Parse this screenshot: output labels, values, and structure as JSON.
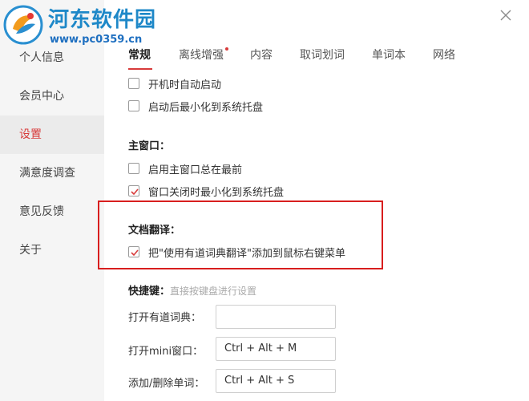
{
  "logo": {
    "title": "河东软件园",
    "url": "www.pc0359.cn"
  },
  "sidebar": {
    "items": [
      {
        "label": "个人信息"
      },
      {
        "label": "会员中心"
      },
      {
        "label": "设置"
      },
      {
        "label": "满意度调查"
      },
      {
        "label": "意见反馈"
      },
      {
        "label": "关于"
      }
    ],
    "active": "设置"
  },
  "tabs": [
    {
      "label": "常规",
      "active": true
    },
    {
      "label": "离线增强",
      "has_dot": true
    },
    {
      "label": "内容"
    },
    {
      "label": "取词划词"
    },
    {
      "label": "单词本"
    },
    {
      "label": "网络"
    }
  ],
  "general": {
    "startup_options": [
      {
        "label": "开机时自动启动",
        "checked": false
      },
      {
        "label": "启动后最小化到系统托盘",
        "checked": false
      }
    ]
  },
  "main_window": {
    "title": "主窗口：",
    "options": [
      {
        "label": "启用主窗口总在最前",
        "checked": false
      },
      {
        "label": "窗口关闭时最小化到系统托盘",
        "checked": true
      }
    ]
  },
  "doc_translate": {
    "title": "文档翻译：",
    "option": {
      "label": "把\"使用有道词典翻译\"添加到鼠标右键菜单",
      "checked": true
    }
  },
  "hotkeys": {
    "title": "快捷键：",
    "hint": "直接按键盘进行设置",
    "items": [
      {
        "label": "打开有道词典：",
        "value": ""
      },
      {
        "label": "打开mini窗口：",
        "value": "Ctrl + Alt + M"
      },
      {
        "label": "添加/删除单词：",
        "value": "Ctrl + Alt + S"
      }
    ]
  },
  "colors": {
    "accent": "#d83b3b",
    "highlight_border": "#d81e1e",
    "logo_blue": "#1e88c8"
  }
}
